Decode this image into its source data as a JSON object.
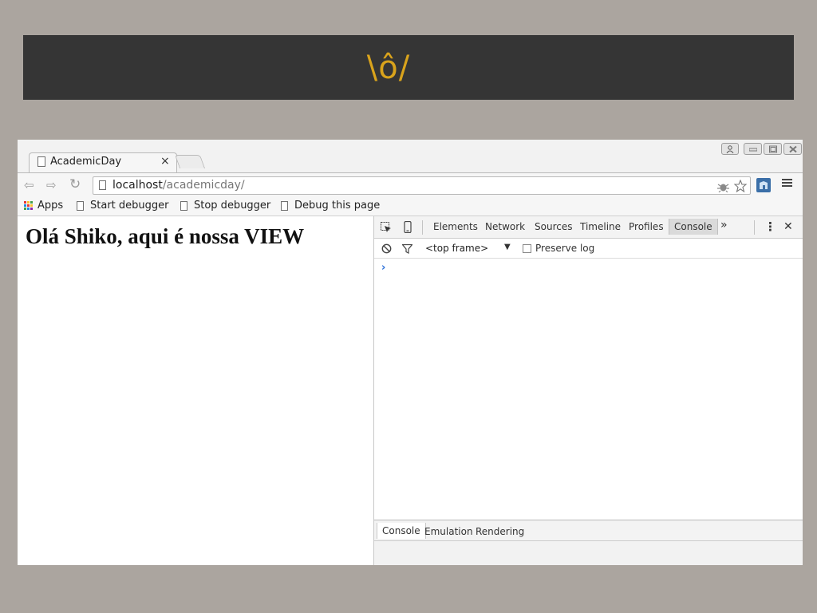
{
  "banner": {
    "text": "\\ô/"
  },
  "browser": {
    "tab": {
      "title": "AcademicDay",
      "close": "×"
    },
    "address": {
      "host": "localhost",
      "path": "/academicday/"
    },
    "nav": {
      "back": "⇦",
      "forward": "⇨",
      "reload": "↻"
    },
    "bookmarks": [
      {
        "label": "Apps",
        "icon": "apps-grid-icon"
      },
      {
        "label": "Start debugger",
        "icon": "page-icon"
      },
      {
        "label": "Stop debugger",
        "icon": "page-icon"
      },
      {
        "label": "Debug this page",
        "icon": "page-icon"
      }
    ],
    "apps_colors": [
      "#e53935",
      "#fbc02d",
      "#43a047",
      "#1e88e5",
      "#e53935",
      "#fbc02d",
      "#43a047",
      "#1e88e5",
      "#8e24aa"
    ]
  },
  "page": {
    "heading": "Olá Shiko, aqui é nossa VIEW"
  },
  "devtools": {
    "tabs": [
      "Elements",
      "Network",
      "Sources",
      "Timeline",
      "Profiles",
      "Console"
    ],
    "active_tab": "Console",
    "more": "»",
    "close": "✕",
    "kebab": "⋮",
    "frame_selector": "<top frame>",
    "frame_arrow": "▼",
    "preserve_log": "Preserve log",
    "prompt": "›",
    "drawer_tabs": [
      "Console",
      "Emulation",
      "Rendering"
    ]
  },
  "colors": {
    "background": "#aba59f",
    "banner": "#353535",
    "banner_text": "#d9a31c",
    "prompt": "#2a6fd8"
  }
}
